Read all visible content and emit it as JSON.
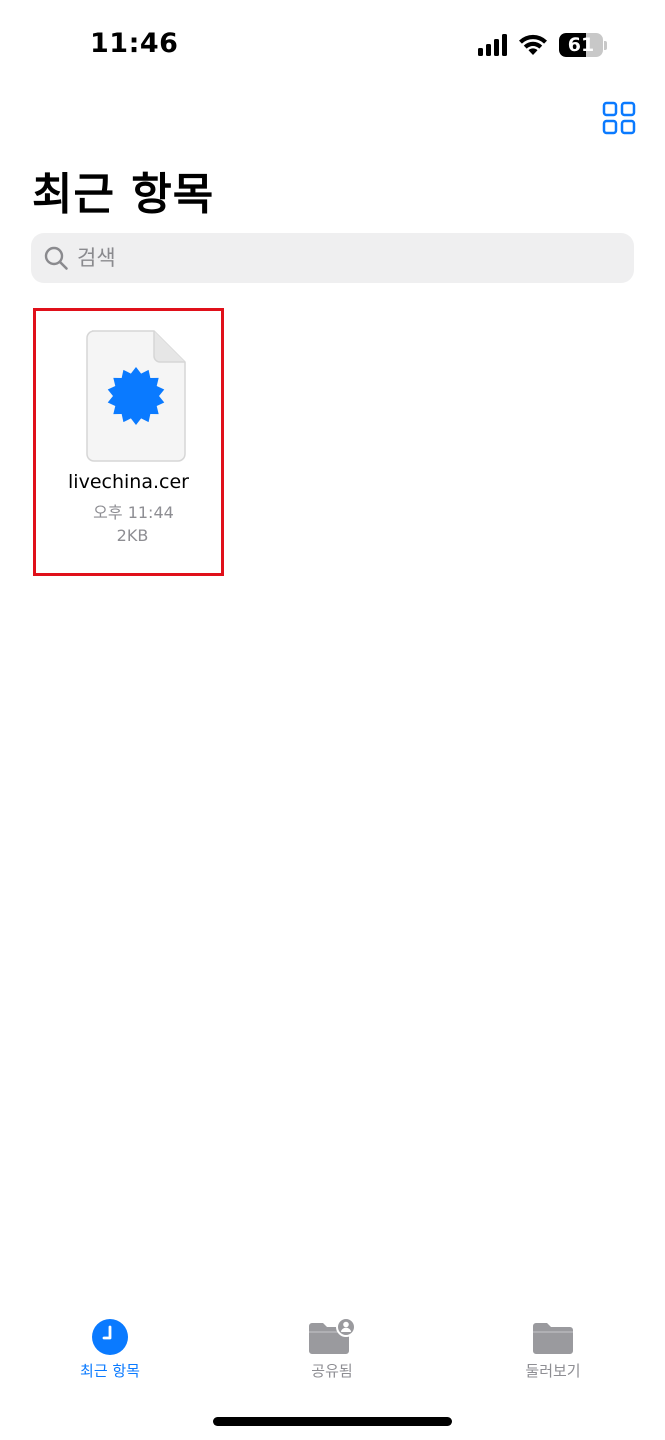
{
  "status_bar": {
    "time": "11:46",
    "battery_level": "61",
    "battery_fraction": 0.61
  },
  "header": {
    "title": "최근 항목",
    "view_toggle_icon": "grid-icon"
  },
  "search": {
    "placeholder": "검색",
    "value": ""
  },
  "files": [
    {
      "name": "livechina.cer",
      "date": "오후 11:44",
      "size": "2KB",
      "icon": "certificate-badge-icon"
    }
  ],
  "tabs": [
    {
      "label": "최근 항목",
      "icon": "clock-icon",
      "active": true
    },
    {
      "label": "공유됨",
      "icon": "shared-folder-icon",
      "active": false
    },
    {
      "label": "둘러보기",
      "icon": "folder-icon",
      "active": false
    }
  ],
  "colors": {
    "accent": "#0a7aff",
    "highlight_border": "#e0101a",
    "tab_inactive": "#8e8e93"
  }
}
